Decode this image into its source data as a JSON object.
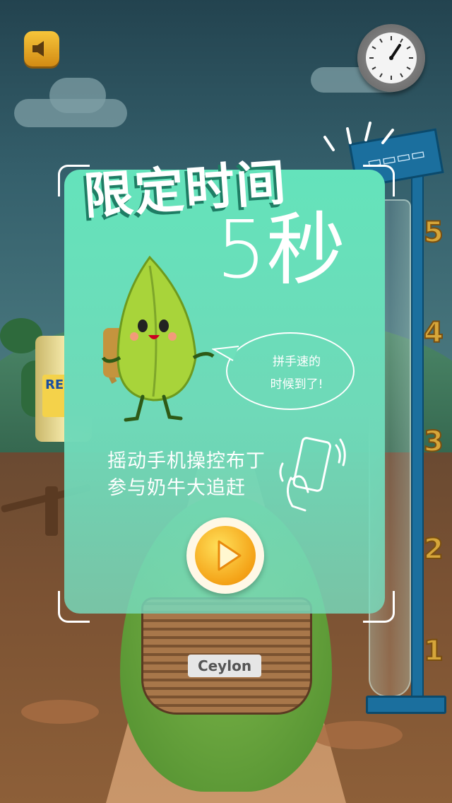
{
  "overlay": {
    "title": "限定时间",
    "countdown": "5秒",
    "bubble_line1": "拼手速的",
    "bubble_line2": "时候到了!",
    "instruction_line1": "摇动手机操控布丁",
    "instruction_line2": "参与奶牛大追赶"
  },
  "scene": {
    "basket_label": "Ceylon",
    "tin_label": "RE",
    "progress_scale": [
      "5",
      "4",
      "3",
      "2",
      "1"
    ]
  },
  "colors": {
    "panel": "#64e3bb",
    "accent": "#1b6f9e",
    "play": "#f4a216"
  },
  "icons": {
    "sound": "speaker-icon",
    "timer": "stopwatch-icon",
    "play": "play-icon",
    "shake": "shake-phone-icon"
  }
}
